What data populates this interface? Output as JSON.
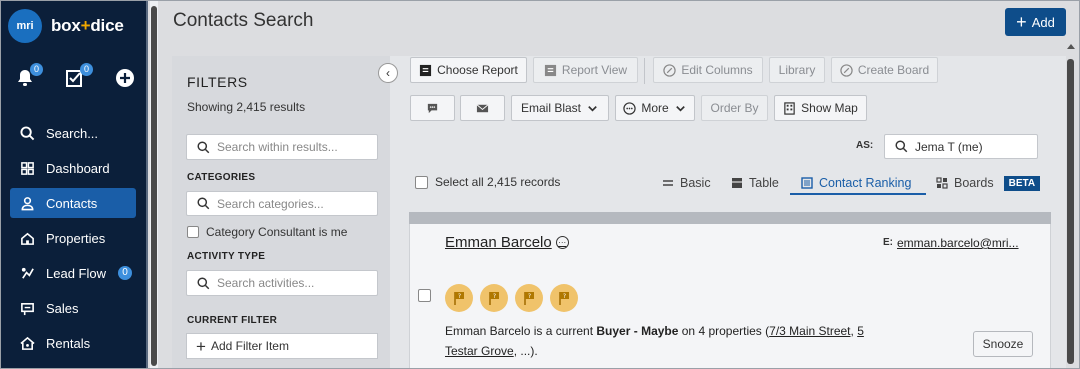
{
  "brand": {
    "logo_text": "mri",
    "name_part1": "box",
    "name_plus": "+",
    "name_part2": "dice"
  },
  "top_icons": {
    "notifications_badge": "0",
    "tasks_badge": "0"
  },
  "nav": [
    {
      "label": "Search..."
    },
    {
      "label": "Dashboard"
    },
    {
      "label": "Contacts",
      "active": true
    },
    {
      "label": "Properties"
    },
    {
      "label": "Lead Flow",
      "badge": "0"
    },
    {
      "label": "Sales"
    },
    {
      "label": "Rentals"
    }
  ],
  "header": {
    "title": "Contacts Search",
    "add_label": "Add"
  },
  "filters": {
    "title": "FILTERS",
    "count": "Showing 2,415 results",
    "search_placeholder": "Search within results...",
    "categories_label": "CATEGORIES",
    "categories_placeholder": "Search categories...",
    "consultant_checkbox": "Category Consultant is me",
    "activity_label": "ACTIVITY TYPE",
    "activity_placeholder": "Search activities...",
    "current_filter_label": "CURRENT FILTER",
    "add_filter": "Add Filter Item"
  },
  "toolbar": {
    "choose_report": "Choose Report",
    "report_view": "Report View",
    "edit_columns": "Edit Columns",
    "library": "Library",
    "create_board": "Create Board",
    "email_blast": "Email Blast",
    "more": "More",
    "order_by": "Order By",
    "show_map": "Show Map"
  },
  "as_filter": {
    "label": "AS:",
    "value": "Jema T (me)"
  },
  "select_all": "Select all 2,415 records",
  "views": {
    "basic": "Basic",
    "table": "Table",
    "ranking": "Contact Ranking",
    "boards": "Boards",
    "beta": "BETA"
  },
  "contact": {
    "name": "Emman Barcelo",
    "email_label": "E:",
    "email": "emman.barcelo@mri...",
    "desc_prefix": "Emman Barcelo is a current ",
    "desc_status": "Buyer - Maybe",
    "desc_mid": " on 4 properties (",
    "desc_link1": "7/3 Main Street",
    "desc_sep": ", ",
    "desc_link2": "5 Testar Grove",
    "desc_tail": ", ...).",
    "snooze": "Snooze"
  },
  "colors": {
    "sidebar": "#0b1f3a",
    "accent": "#1a5ea8",
    "primary_button": "#0e4d8a",
    "flag": "#f0c36b"
  }
}
